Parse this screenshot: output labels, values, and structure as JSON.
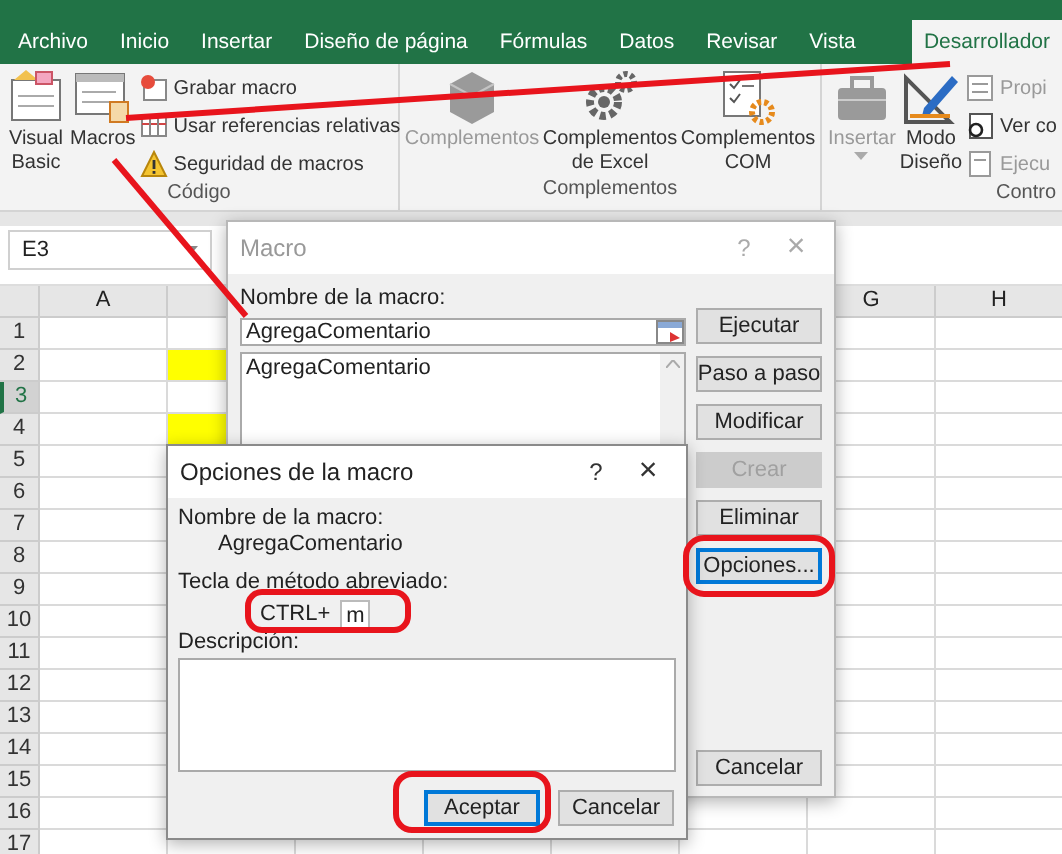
{
  "ribbon": {
    "tabs": [
      {
        "label": "Archivo",
        "selected": false
      },
      {
        "label": "Inicio",
        "selected": false
      },
      {
        "label": "Insertar",
        "selected": false
      },
      {
        "label": "Diseño de página",
        "selected": false
      },
      {
        "label": "Fórmulas",
        "selected": false
      },
      {
        "label": "Datos",
        "selected": false
      },
      {
        "label": "Revisar",
        "selected": false
      },
      {
        "label": "Vista",
        "selected": false
      },
      {
        "label": "Desarrollador",
        "selected": true
      }
    ],
    "groups": [
      {
        "label": "Código",
        "items": [
          {
            "kind": "large",
            "label": "Visual Basic",
            "disabled": false
          },
          {
            "kind": "large",
            "label": "Macros",
            "disabled": false
          },
          {
            "kind": "small",
            "label": "Grabar macro",
            "disabled": false
          },
          {
            "kind": "small",
            "label": "Usar referencias relativas",
            "disabled": false
          },
          {
            "kind": "small",
            "label": "Seguridad de macros",
            "disabled": false
          }
        ]
      },
      {
        "label": "Complementos",
        "items": [
          {
            "kind": "large",
            "label": "Complementos",
            "disabled": true
          },
          {
            "kind": "large",
            "label": "Complementos de Excel",
            "disabled": false
          },
          {
            "kind": "large",
            "label": "Complementos COM",
            "disabled": false
          }
        ]
      },
      {
        "label": "Contro",
        "items": [
          {
            "kind": "large",
            "label": "Insertar",
            "disabled": true
          },
          {
            "kind": "large",
            "label": "Modo Diseño",
            "disabled": false
          },
          {
            "kind": "small",
            "label": "Propi",
            "disabled": true
          },
          {
            "kind": "small",
            "label": "Ver co",
            "disabled": false
          },
          {
            "kind": "small",
            "label": "Ejecu",
            "disabled": true
          }
        ]
      }
    ]
  },
  "name_box": "E3",
  "grid": {
    "columns_left": [
      {
        "label": "A"
      }
    ],
    "columns_right": [
      {
        "label": "G"
      },
      {
        "label": "H"
      }
    ],
    "rows": [
      {
        "label": "1",
        "selected": false,
        "b_filled": false
      },
      {
        "label": "2",
        "selected": false,
        "b_filled": true
      },
      {
        "label": "3",
        "selected": true,
        "b_filled": false
      },
      {
        "label": "4",
        "selected": false,
        "b_filled": true
      },
      {
        "label": "5",
        "selected": false
      },
      {
        "label": "6",
        "selected": false
      },
      {
        "label": "7",
        "selected": false
      },
      {
        "label": "8",
        "selected": false
      },
      {
        "label": "9",
        "selected": false
      },
      {
        "label": "10",
        "selected": false
      },
      {
        "label": "11",
        "selected": false
      },
      {
        "label": "12",
        "selected": false
      },
      {
        "label": "13",
        "selected": false
      },
      {
        "label": "14",
        "selected": false
      },
      {
        "label": "15",
        "selected": false
      },
      {
        "label": "16",
        "selected": false
      },
      {
        "label": "17",
        "selected": false
      }
    ]
  },
  "macro_dialog": {
    "title": "Macro",
    "help": "?",
    "close": "×",
    "name_label": "Nombre de la macro:",
    "name_value": "AgregaComentario",
    "list": [
      {
        "label": "AgregaComentario"
      }
    ],
    "buttons": [
      {
        "label": "Ejecutar",
        "disabled": false,
        "focused": false
      },
      {
        "label": "Paso a paso",
        "disabled": false,
        "focused": false
      },
      {
        "label": "Modificar",
        "disabled": false,
        "focused": false
      },
      {
        "label": "Crear",
        "disabled": true,
        "focused": false
      },
      {
        "label": "Eliminar",
        "disabled": false,
        "focused": false
      },
      {
        "label": "Opciones...",
        "disabled": false,
        "focused": true
      }
    ],
    "cancel": "Cancelar"
  },
  "options_dialog": {
    "title": "Opciones de la macro",
    "help": "?",
    "close": "×",
    "name_label": "Nombre de la macro:",
    "name_value": "AgregaComentario",
    "shortcut_label": "Tecla de método abreviado:",
    "shortcut_prefix": "CTRL+",
    "shortcut_value": "m",
    "description_label": "Descripción:",
    "buttons": [
      {
        "label": "Aceptar",
        "focused": true
      },
      {
        "label": "Cancelar",
        "focused": false
      }
    ]
  }
}
